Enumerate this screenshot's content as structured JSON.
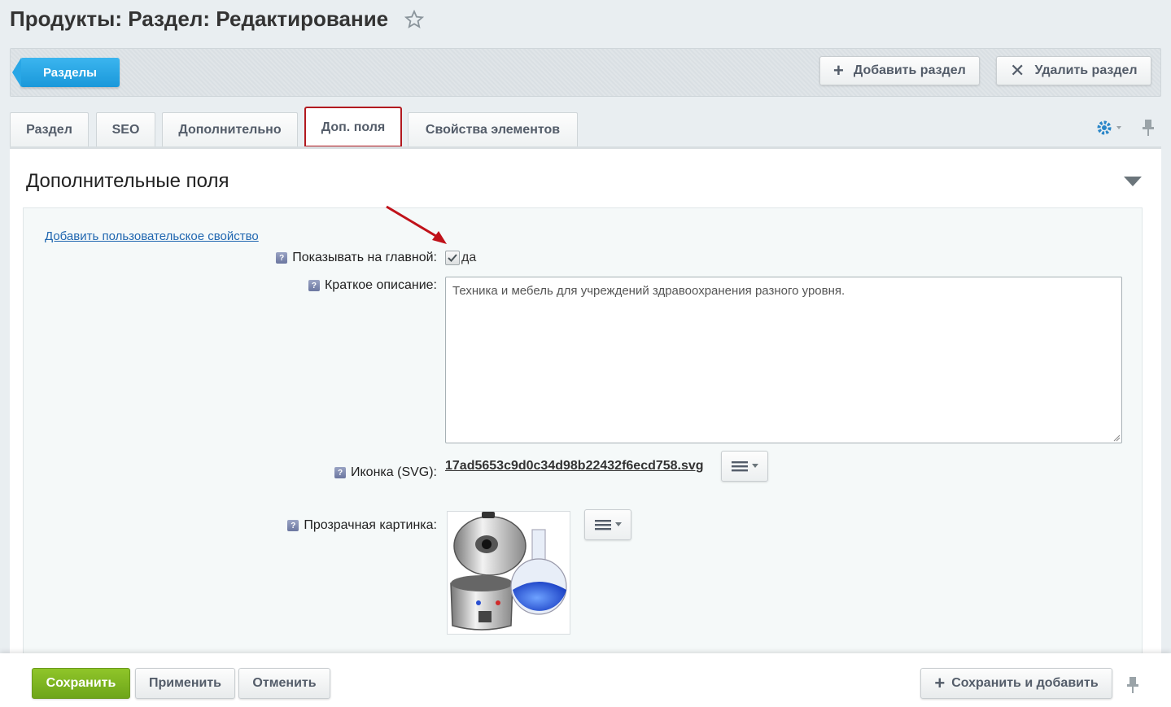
{
  "page": {
    "title": "Продукты: Раздел: Редактирование"
  },
  "toolbar": {
    "back_label": "Разделы",
    "add_label": "Добавить раздел",
    "delete_label": "Удалить раздел"
  },
  "tabs": [
    {
      "label": "Раздел"
    },
    {
      "label": "SEO"
    },
    {
      "label": "Дополнительно"
    },
    {
      "label": "Доп. поля",
      "active": true
    },
    {
      "label": "Свойства элементов"
    }
  ],
  "section": {
    "title": "Дополнительные поля",
    "add_property_link": "Добавить пользовательское свойство"
  },
  "fields": {
    "show_on_main": {
      "label": "Показывать на главной:",
      "value_label": "да",
      "checked": true
    },
    "short_description": {
      "label": "Краткое описание:",
      "value": "Техника и мебель для учреждений здравоохранения разного уровня."
    },
    "icon_svg": {
      "label": "Иконка (SVG):",
      "file": "17ad5653c9d0c34d98b22432f6ecd758.svg"
    },
    "transparent_image": {
      "label": "Прозрачная картинка:"
    }
  },
  "footer": {
    "save_label": "Сохранить",
    "apply_label": "Применить",
    "cancel_label": "Отменить",
    "save_add_label": "Сохранить и добавить"
  },
  "colors": {
    "accent_blue": "#1a98da",
    "save_green": "#7ab522",
    "active_tab_outline": "#b2191f",
    "arrow_red": "#c0121a"
  }
}
